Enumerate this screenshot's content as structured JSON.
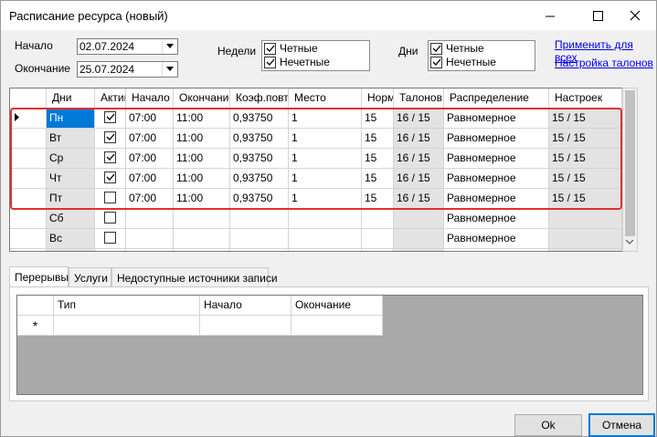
{
  "window": {
    "title": "Расписание ресурса (новый)"
  },
  "dates": {
    "start_label": "Начало",
    "start_value": "02.07.2024",
    "end_label": "Окончание",
    "end_value": "25.07.2024"
  },
  "weeks": {
    "label": "Недели",
    "even": "Четные",
    "odd": "Нечетные"
  },
  "days": {
    "label": "Дни",
    "even": "Четные",
    "odd": "Нечетные"
  },
  "links": {
    "apply_all": "Применить для всех",
    "tickets_setup": "Настройка талонов"
  },
  "grid": {
    "columns": [
      "Дни",
      "Актив",
      "Начало",
      "Окончание",
      "Коэф.повт.",
      "Место",
      "Норм",
      "Талонов",
      "Распределение",
      "Настроек"
    ],
    "rows": [
      {
        "day": "Пн",
        "active": true,
        "start": "07:00",
        "end": "11:00",
        "coef": "0,93750",
        "place": "1",
        "norm": "15",
        "tickets": "16 / 15",
        "distribution": "Равномерное",
        "settings": "15 / 15",
        "selected": true
      },
      {
        "day": "Вт",
        "active": true,
        "start": "07:00",
        "end": "11:00",
        "coef": "0,93750",
        "place": "1",
        "norm": "15",
        "tickets": "16 / 15",
        "distribution": "Равномерное",
        "settings": "15 / 15"
      },
      {
        "day": "Ср",
        "active": true,
        "start": "07:00",
        "end": "11:00",
        "coef": "0,93750",
        "place": "1",
        "norm": "15",
        "tickets": "16 / 15",
        "distribution": "Равномерное",
        "settings": "15 / 15"
      },
      {
        "day": "Чт",
        "active": true,
        "start": "07:00",
        "end": "11:00",
        "coef": "0,93750",
        "place": "1",
        "norm": "15",
        "tickets": "16 / 15",
        "distribution": "Равномерное",
        "settings": "15 / 15"
      },
      {
        "day": "Пт",
        "active": false,
        "start": "07:00",
        "end": "11:00",
        "coef": "0,93750",
        "place": "1",
        "norm": "15",
        "tickets": "16 / 15",
        "distribution": "Равномерное",
        "settings": "15 / 15"
      },
      {
        "day": "Сб",
        "active": false,
        "start": "",
        "end": "",
        "coef": "",
        "place": "",
        "norm": "",
        "tickets": "",
        "distribution": "Равномерное",
        "settings": ""
      },
      {
        "day": "Вс",
        "active": false,
        "start": "",
        "end": "",
        "coef": "",
        "place": "",
        "norm": "",
        "tickets": "",
        "distribution": "Равномерное",
        "settings": ""
      }
    ]
  },
  "tabs": [
    "Перерывы",
    "Услуги",
    "Недоступные источники записи"
  ],
  "breaks": {
    "columns": [
      "Тип",
      "Начало",
      "Окончание"
    ],
    "new_row_marker": "*"
  },
  "buttons": {
    "ok": "Ok",
    "cancel": "Отмена"
  },
  "colors": {
    "highlight_border": "#e03030",
    "selection": "#0078d7",
    "link": "#0000ee"
  }
}
